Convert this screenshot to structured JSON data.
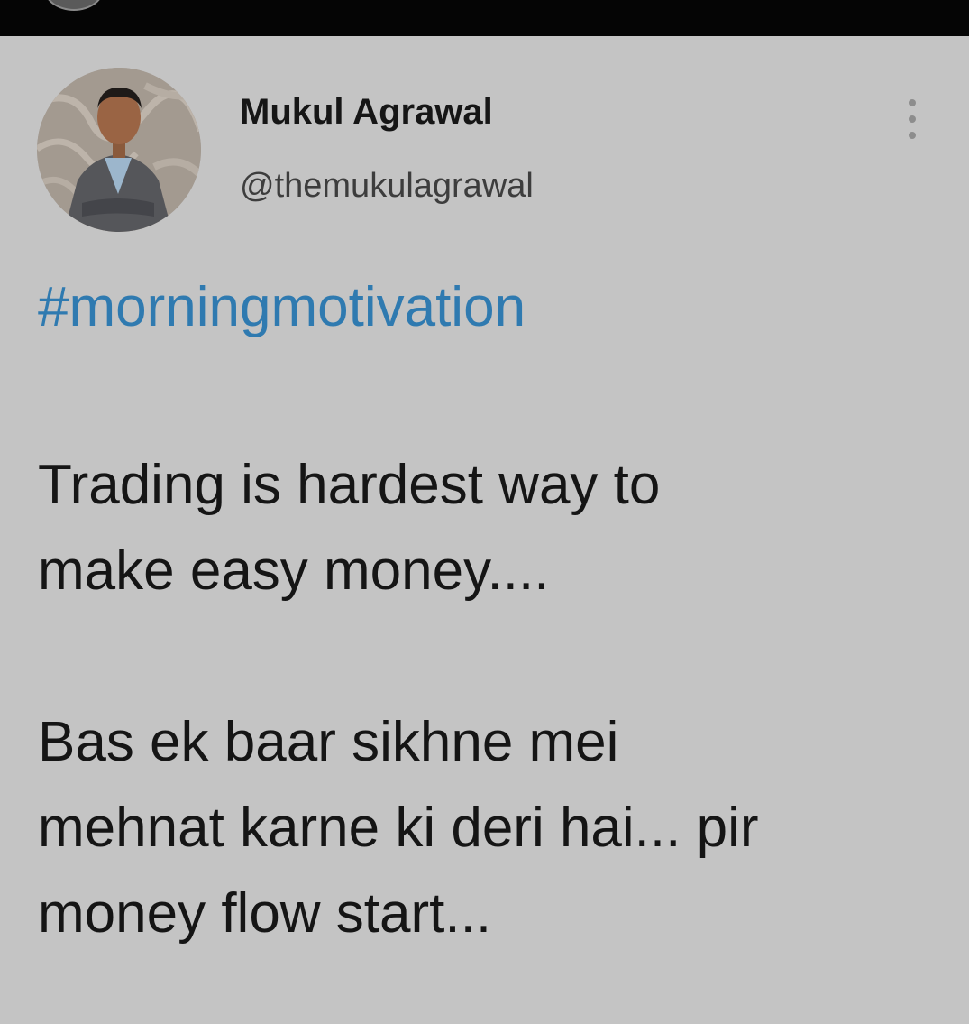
{
  "colors": {
    "background": "#c4c4c4",
    "top_bar": "#050505",
    "hashtag": "#2f7ab0",
    "text": "#151515",
    "handle": "#3d3d3d"
  },
  "tweet": {
    "author": {
      "display_name": "Mukul Agrawal",
      "handle": "@themukulagrawal",
      "avatar_icon": "profile-photo"
    },
    "more_icon": "vertical-ellipsis-icon",
    "hashtag": "#morningmotivation",
    "paragraph_1": {
      "line_1": "Trading is hardest way to",
      "line_2": "make easy money...."
    },
    "paragraph_2": {
      "line_1": "Bas ek baar sikhne mei",
      "line_2": "mehnat karne ki deri hai... pir",
      "line_3": "money flow start..."
    }
  }
}
